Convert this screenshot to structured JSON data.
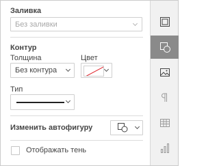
{
  "fill": {
    "title": "Заливка",
    "value": "Без заливки"
  },
  "stroke": {
    "title": "Контур",
    "width_label": "Толщина",
    "width_value": "Без контура",
    "color_label": "Цвет",
    "type_label": "Тип"
  },
  "autoshape": {
    "label": "Изменить автофигуру"
  },
  "shadow": {
    "label": "Отображать тень",
    "checked": false
  },
  "rail": {
    "active": "shape-settings",
    "items": [
      "slide-settings",
      "shape-settings",
      "image-settings",
      "paragraph-settings",
      "table-settings",
      "chart-settings"
    ]
  },
  "colors": {
    "active_rail": "#8a8a8a",
    "no_color_line": "#e0242c",
    "rail_bg": "#f1f1f1"
  }
}
